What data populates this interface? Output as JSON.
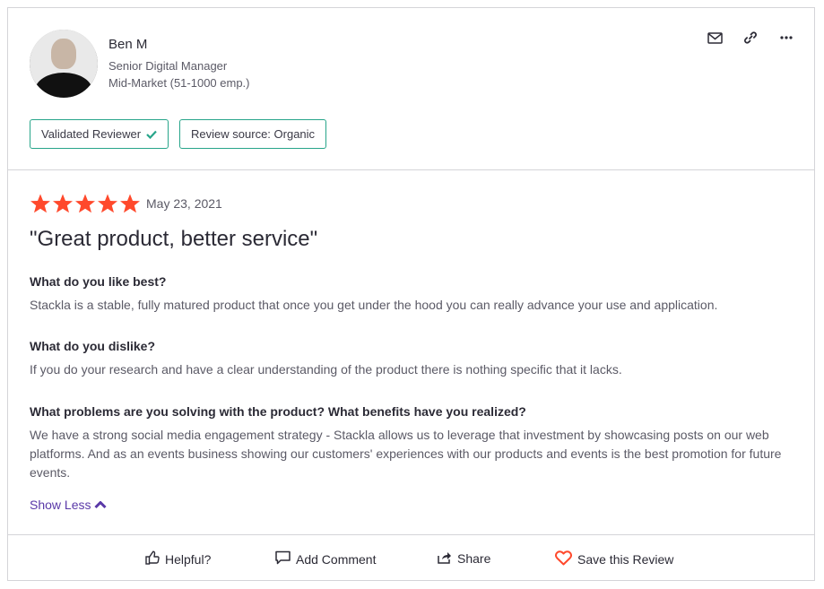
{
  "reviewer": {
    "name": "Ben M",
    "title": "Senior Digital Manager",
    "segment": "Mid-Market (51-1000 emp.)"
  },
  "badges": {
    "validated": "Validated Reviewer",
    "source": "Review source: Organic"
  },
  "review": {
    "rating": 5,
    "date": "May 23, 2021",
    "title": "\"Great product, better service\"",
    "qa": [
      {
        "question": "What do you like best?",
        "answer": "Stackla is a stable, fully matured product that once you get under the hood you can really advance your use and application."
      },
      {
        "question": "What do you dislike?",
        "answer": "If you do your research and have a clear understanding of the product there is nothing specific that it lacks."
      },
      {
        "question": "What problems are you solving with the product? What benefits have you realized?",
        "answer": "We have a strong social media engagement strategy - Stackla allows us to leverage that investment by showcasing posts on our web platforms. And as an events business showing our customers' experiences with our products and events is the best promotion for future events."
      }
    ],
    "show_less": "Show Less"
  },
  "actions": {
    "helpful": "Helpful?",
    "comment": "Add Comment",
    "share": "Share",
    "save": "Save this Review"
  },
  "colors": {
    "star": "#ff492c",
    "badge_border": "#27a58a",
    "link": "#5a39a8",
    "heart": "#ff492c"
  },
  "icons": [
    "mail-icon",
    "link-icon",
    "more-icon",
    "check-icon",
    "star-icon",
    "chevron-up-icon",
    "thumbs-up-icon",
    "comment-icon",
    "share-icon",
    "heart-icon"
  ]
}
